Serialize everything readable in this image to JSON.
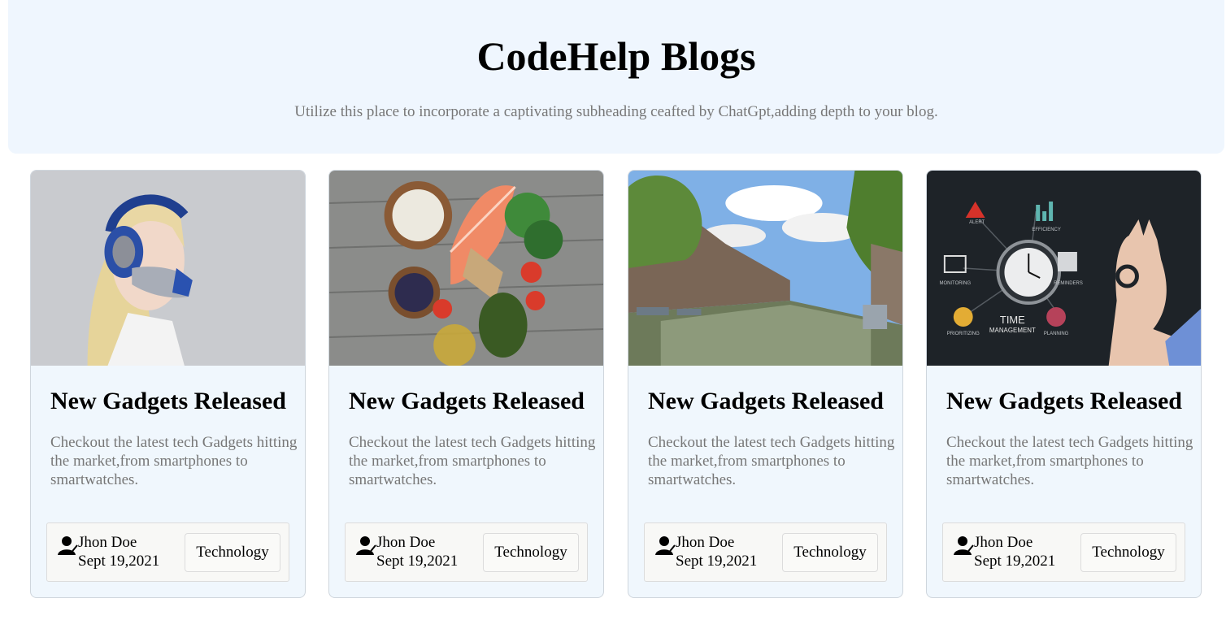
{
  "header": {
    "title": "CodeHelp Blogs",
    "subtitle": "Utilize this place to incorporate a captivating subheading ceafted by ChatGpt,adding depth to your blog."
  },
  "cards": [
    {
      "image": "person-wearing-headphone-air-purifier",
      "title": "New Gadgets Released",
      "description": "Checkout the latest tech Gadgets hitting the market,from smartphones to smartwatches.",
      "author": "Jhon Doe",
      "date": "Sept 19,2021",
      "tag": "Technology"
    },
    {
      "image": "healthy-food-salmon-vegetables",
      "title": "New Gadgets Released",
      "description": "Checkout the latest tech Gadgets hitting the market,from smartphones to smartwatches.",
      "author": "Jhon Doe",
      "date": "Sept 19,2021",
      "tag": "Technology"
    },
    {
      "image": "amsterdam-canal",
      "title": "New Gadgets Released",
      "description": "Checkout the latest tech Gadgets hitting the market,from smartphones to smartwatches.",
      "author": "Jhon Doe",
      "date": "Sept 19,2021",
      "tag": "Technology"
    },
    {
      "image": "time-management-clock",
      "title": "New Gadgets Released",
      "description": "Checkout the latest tech Gadgets hitting the market,from smartphones to smartwatches.",
      "author": "Jhon Doe",
      "date": "Sept 19,2021",
      "tag": "Technology"
    }
  ],
  "time_management_image": {
    "heading_line1": "TIME",
    "heading_line2": "MANAGEMENT",
    "labels": [
      "ALERT",
      "EFFICIENCY",
      "MONITORING",
      "REMINDERS",
      "PRIORITIZING",
      "PLANNING"
    ]
  },
  "colors": {
    "header_bg": "#eff6fe",
    "card_bg": "#f0f7fd",
    "muted_text": "#777777"
  }
}
